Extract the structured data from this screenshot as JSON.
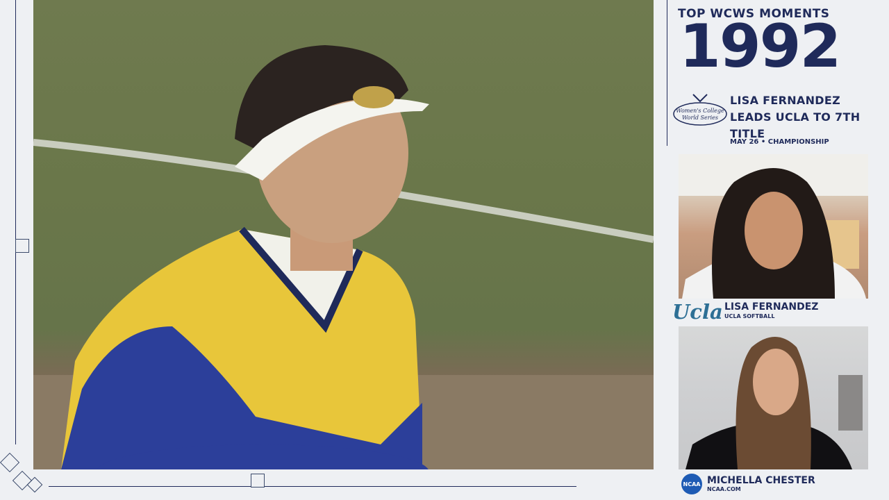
{
  "header": {
    "series_title": "TOP WCWS MOMENTS",
    "year": "1992",
    "headline": "LISA FERNANDEZ LEADS UCLA TO 7TH TITLE",
    "date": "MAY 26",
    "separator": "•",
    "round": "CHAMPIONSHIP",
    "event_logo": "Women's College World Series"
  },
  "guest": {
    "team_logo": "Ucla",
    "name": "LISA FERNANDEZ",
    "affiliation": "UCLA SOFTBALL"
  },
  "host": {
    "network_logo": "NCAA",
    "name": "MICHELLA CHESTER",
    "affiliation": "NCAA.COM"
  },
  "colors": {
    "navy": "#1f2a5a",
    "ucla_blue": "#2d6f95",
    "ncaa_blue": "#1e5bb4",
    "jersey_yellow": "#e8c63a",
    "jersey_blue": "#2c3f9a"
  }
}
